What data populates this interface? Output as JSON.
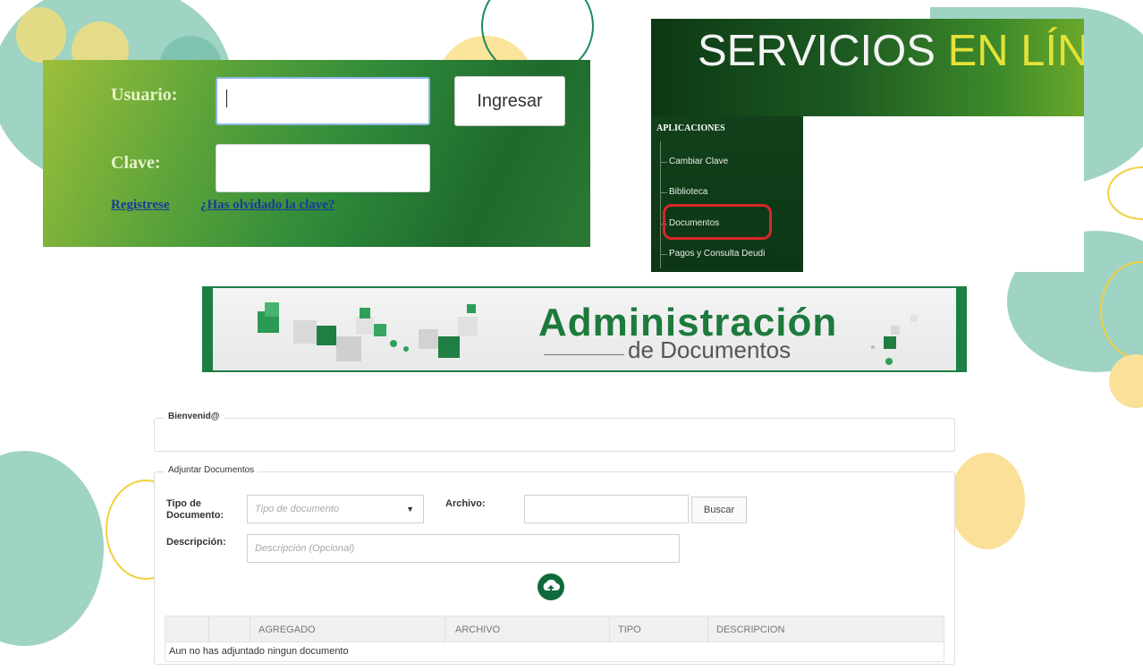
{
  "login": {
    "usuario_label": "Usuario:",
    "clave_label": "Clave:",
    "ingresar_button": "Ingresar",
    "register_link": "Registrese",
    "forgot_link": "¿Has olvidado la clave?"
  },
  "services": {
    "title_main": "SERVICIOS",
    "title_highlight": "EN LÍN",
    "section_title": "APLICACIONES",
    "items": [
      {
        "label": "Cambiar Clave"
      },
      {
        "label": "Biblioteca"
      },
      {
        "label": "Documentos",
        "highlighted": true
      },
      {
        "label": "Pagos y Consulta Deudi"
      }
    ]
  },
  "banner": {
    "title": "Administración",
    "subtitle": "de Documentos"
  },
  "form": {
    "welcome_legend": "Bienvenid@",
    "attach_legend": "Adjuntar Documentos",
    "doc_type_label_line1": "Tipo de",
    "doc_type_label_line2": "Documento:",
    "doc_type_placeholder": "Tipo de documento",
    "file_label": "Archivo:",
    "search_button": "Buscar",
    "description_label": "Descripción:",
    "description_placeholder": "Descripción (Opcional)",
    "upload_icon": "cloud-upload-icon"
  },
  "table": {
    "columns": [
      "AGREGADO",
      "ARCHIVO",
      "TIPO",
      "DESCRIPCION"
    ],
    "empty_message": "Aun no has adjuntado ningun documento"
  },
  "colors": {
    "primary_green": "#1b7f44",
    "highlight_red": "#d62828",
    "accent_yellow": "#e4e237",
    "link_blue": "#1a3a9c"
  }
}
